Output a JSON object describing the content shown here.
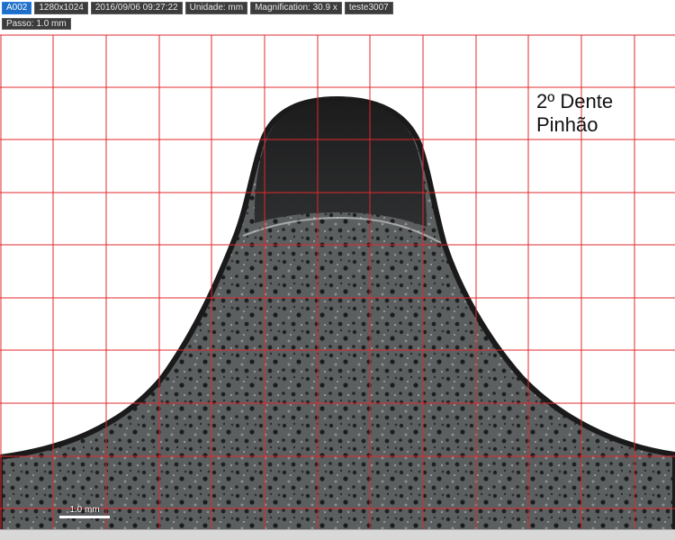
{
  "header": {
    "image_id": "A002",
    "resolution": "1280x1024",
    "datetime": "2016/09/06 09:27:22",
    "unit": "Unidade: mm",
    "magnification": "Magnification:  30.9 x",
    "sample": "teste3007"
  },
  "step": "Passo: 1.0 mm",
  "annotation": {
    "line1": "2º Dente",
    "line2": "Pinhão"
  },
  "scale_bar": "1.0 mm",
  "colors": {
    "grid": "#e0282e",
    "metal": "#4a4d4f",
    "crown": "#252526",
    "background": "#ffffff"
  }
}
